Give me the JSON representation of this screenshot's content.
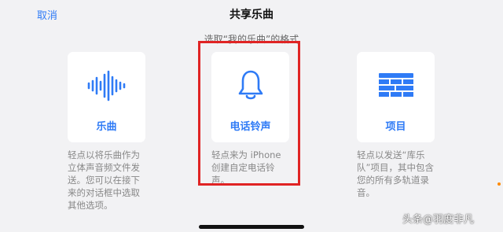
{
  "header": {
    "cancel_label": "取消",
    "title": "共享乐曲"
  },
  "subtitle": "选取“我的乐曲”的格式",
  "options": [
    {
      "label": "乐曲",
      "icon": "waveform-icon",
      "description": "轻点以将乐曲作为立体声音频文件发送。您可以在接下来的对话框中选取其他选项。"
    },
    {
      "label": "电话铃声",
      "icon": "bell-icon",
      "description": "轻点来为 iPhone 创建自定电话铃声。"
    },
    {
      "label": "项目",
      "icon": "bricks-icon",
      "description": "轻点以发送“库乐队”项目，其中包含您的所有多轨道录音。"
    }
  ],
  "watermark": "头条@羽度非凡",
  "colors": {
    "accent": "#2f7bf6",
    "highlight": "#e02424",
    "background": "#f2f2f4"
  }
}
